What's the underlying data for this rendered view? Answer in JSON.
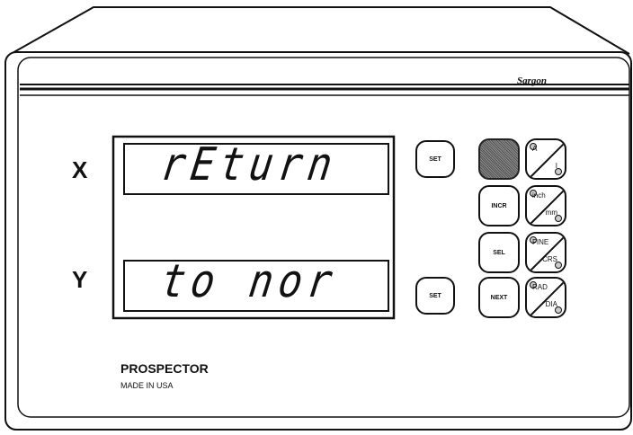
{
  "device": {
    "brand": "Sargon",
    "model": "PROSPECTOR",
    "origin": "MADE IN USA"
  },
  "axes": [
    {
      "label": "X",
      "display": "rEturn"
    },
    {
      "label": "Y",
      "display": "to nor"
    }
  ],
  "set_button_label": "SET",
  "keys": {
    "incr": "INCR",
    "sel": "SEL",
    "next": "NEXT"
  },
  "mode_buttons": [
    {
      "top": "A",
      "bottom": "I"
    },
    {
      "top": "inch",
      "bottom": "mm"
    },
    {
      "top": "FINE",
      "bottom": "CRS"
    },
    {
      "top": "RAD",
      "bottom": "DIA"
    }
  ]
}
